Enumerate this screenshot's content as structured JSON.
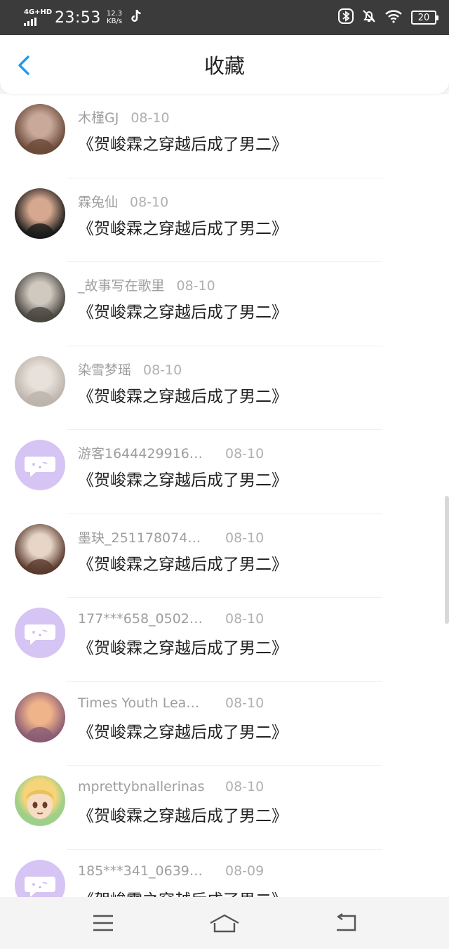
{
  "status_bar": {
    "network": "4G+HD",
    "time": "23:53",
    "speed_value": "12.3",
    "speed_unit": "KB/s",
    "battery": "20",
    "icons": [
      "tiktok-icon",
      "bluetooth-icon",
      "mute-icon",
      "wifi-icon",
      "battery-icon"
    ]
  },
  "header": {
    "title": "收藏"
  },
  "favorites": [
    {
      "user": "木槿GJ",
      "date": "08-10",
      "title": "《贺峻霖之穿越后成了男二》",
      "avatar": "photo-avatar",
      "avatar_colors": [
        "#6b4a3a",
        "#c9a99a"
      ]
    },
    {
      "user": "霖兔仙",
      "date": "08-10",
      "title": "《贺峻霖之穿越后成了男二》",
      "avatar": "photo-avatar",
      "avatar_colors": [
        "#1a1a1a",
        "#d6a88f"
      ]
    },
    {
      "user": "_故事写在歌里",
      "date": "08-10",
      "title": "《贺峻霖之穿越后成了男二》",
      "avatar": "photo-avatar",
      "avatar_colors": [
        "#4a4640",
        "#cfc9c0"
      ]
    },
    {
      "user": "染雪梦瑶",
      "date": "08-10",
      "title": "《贺峻霖之穿越后成了男二》",
      "avatar": "photo-avatar",
      "avatar_colors": [
        "#bdb4ac",
        "#e8e1da"
      ]
    },
    {
      "user": "游客1644429916…",
      "date": "08-10",
      "title": "《贺峻霖之穿越后成了男二》",
      "avatar": "default-avatar",
      "avatar_colors": [
        "#d6c4f4",
        "#ffffff"
      ]
    },
    {
      "user": "墨玦_251178074…",
      "date": "08-10",
      "title": "《贺峻霖之穿越后成了男二》",
      "avatar": "photo-avatar",
      "avatar_colors": [
        "#5a3b2e",
        "#e6d5c6"
      ]
    },
    {
      "user": "177***658_0502…",
      "date": "08-10",
      "title": "《贺峻霖之穿越后成了男二》",
      "avatar": "default-avatar",
      "avatar_colors": [
        "#d6c4f4",
        "#ffffff"
      ]
    },
    {
      "user": "Times Youth Lea…",
      "date": "08-10",
      "title": "《贺峻霖之穿越后成了男二》",
      "avatar": "photo-avatar",
      "avatar_colors": [
        "#8a5c74",
        "#f0b48a"
      ]
    },
    {
      "user": "mprettybnallerinas",
      "date": "08-10",
      "title": "《贺峻霖之穿越后成了男二》",
      "avatar": "cartoon-avatar",
      "avatar_colors": [
        "#9fd08a",
        "#f6d57a"
      ]
    },
    {
      "user": "185***341_0639…",
      "date": "08-09",
      "title": "《贺峻霖之穿越后成了男二》",
      "avatar": "default-avatar",
      "avatar_colors": [
        "#d6c4f4",
        "#ffffff"
      ]
    }
  ],
  "nav_bar": {
    "buttons": [
      "menu-icon",
      "home-icon",
      "back-icon"
    ]
  },
  "colors": {
    "accent": "#1e9bf0",
    "default_avatar": "#d6c4f4"
  }
}
